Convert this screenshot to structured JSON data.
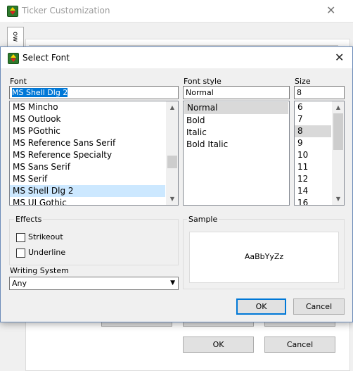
{
  "background_window": {
    "title": "Ticker Customization",
    "side_tab_label": "ow",
    "ok_label": "OK",
    "cancel_label": "Cancel"
  },
  "dialog": {
    "title": "Select Font",
    "font": {
      "label": "Font",
      "value": "MS Shell Dlg 2",
      "items": [
        "MS Mincho",
        "MS Outlook",
        "MS PGothic",
        "MS Reference Sans Serif",
        "MS Reference Specialty",
        "MS Sans Serif",
        "MS Serif",
        "MS Shell Dlg 2",
        "MS UI Gothic"
      ],
      "selected": "MS Shell Dlg 2"
    },
    "font_style": {
      "label": "Font style",
      "value": "Normal",
      "items": [
        "Normal",
        "Bold",
        "Italic",
        "Bold Italic"
      ],
      "selected": "Normal"
    },
    "size": {
      "label": "Size",
      "value": "8",
      "items": [
        "6",
        "7",
        "8",
        "9",
        "10",
        "11",
        "12",
        "14",
        "16"
      ],
      "selected": "8"
    },
    "effects": {
      "label": "Effects",
      "strikeout": {
        "label": "Strikeout",
        "checked": false
      },
      "underline": {
        "label": "Underline",
        "checked": false
      }
    },
    "sample": {
      "label": "Sample",
      "text": "AaBbYyZz"
    },
    "writing_system": {
      "label": "Writing System",
      "value": "Any"
    },
    "ok_label": "OK",
    "cancel_label": "Cancel"
  },
  "colors": {
    "selection_blue": "#cce8ff",
    "text_selection": "#0078d7",
    "primary_border": "#0078d7"
  }
}
